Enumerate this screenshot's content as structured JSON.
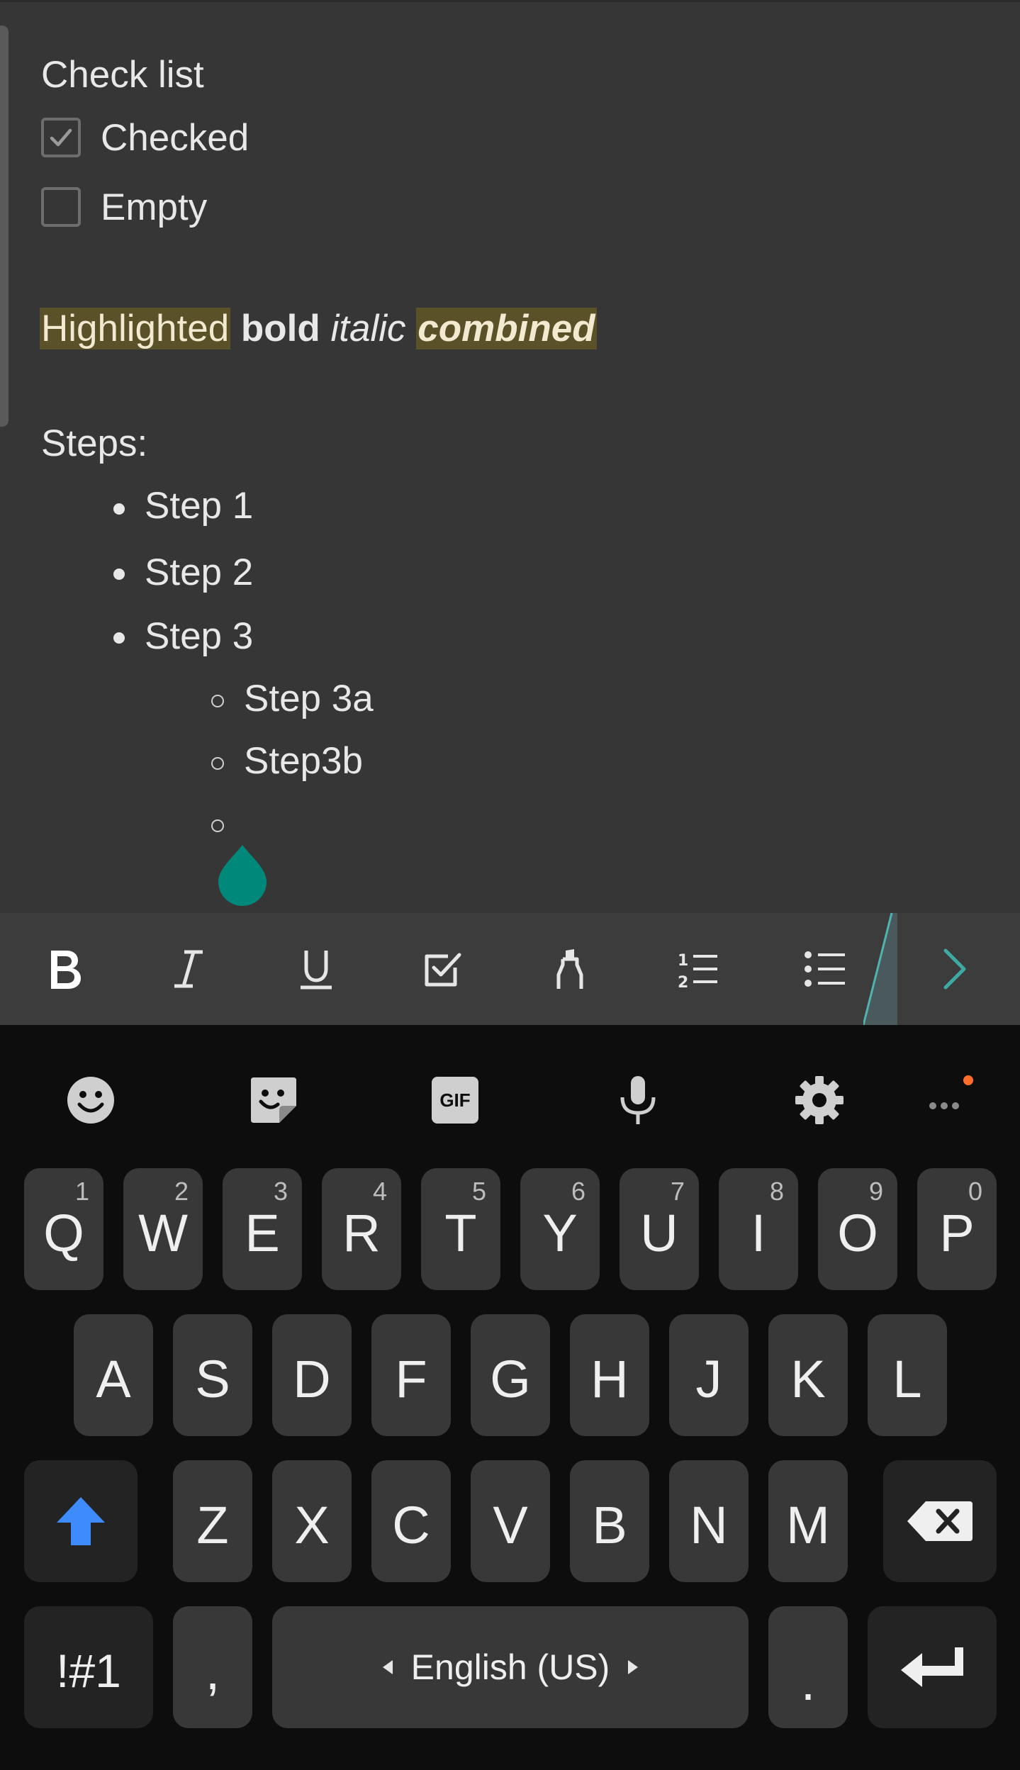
{
  "note": {
    "checklist_title": "Check list",
    "items": [
      {
        "label": "Checked",
        "checked": true
      },
      {
        "label": "Empty",
        "checked": false
      }
    ],
    "format_line": {
      "highlighted": "Highlighted",
      "bold": "bold",
      "italic": "italic",
      "combined": "combined"
    },
    "steps_title": "Steps:",
    "steps": [
      "Step 1",
      "Step 2",
      "Step 3"
    ],
    "substeps": [
      "Step 3a",
      "Step3b",
      ""
    ]
  },
  "colors": {
    "accent": "#00897b",
    "highlight": "#5a5128",
    "shift": "#3d8bfd",
    "notification_dot": "#ff6d2d"
  },
  "toolbar": {
    "buttons": [
      "bold-icon",
      "italic-icon",
      "underline-icon",
      "checkbox-icon",
      "highlighter-icon",
      "numbered-list-icon",
      "bullet-list-icon",
      "chevron-right-icon"
    ]
  },
  "keyboard": {
    "tools": [
      "emoji-icon",
      "sticker-icon",
      "gif-icon",
      "microphone-icon",
      "settings-icon",
      "more-icon"
    ],
    "gif_label": "GIF",
    "row1": [
      {
        "key": "Q",
        "num": "1"
      },
      {
        "key": "W",
        "num": "2"
      },
      {
        "key": "E",
        "num": "3"
      },
      {
        "key": "R",
        "num": "4"
      },
      {
        "key": "T",
        "num": "5"
      },
      {
        "key": "Y",
        "num": "6"
      },
      {
        "key": "U",
        "num": "7"
      },
      {
        "key": "I",
        "num": "8"
      },
      {
        "key": "O",
        "num": "9"
      },
      {
        "key": "P",
        "num": "0"
      }
    ],
    "row2": [
      "A",
      "S",
      "D",
      "F",
      "G",
      "H",
      "J",
      "K",
      "L"
    ],
    "row3": [
      "Z",
      "X",
      "C",
      "V",
      "B",
      "N",
      "M"
    ],
    "symbols_label": "!#1",
    "comma_label": ",",
    "space_label": "English (US)",
    "period_label": "."
  }
}
